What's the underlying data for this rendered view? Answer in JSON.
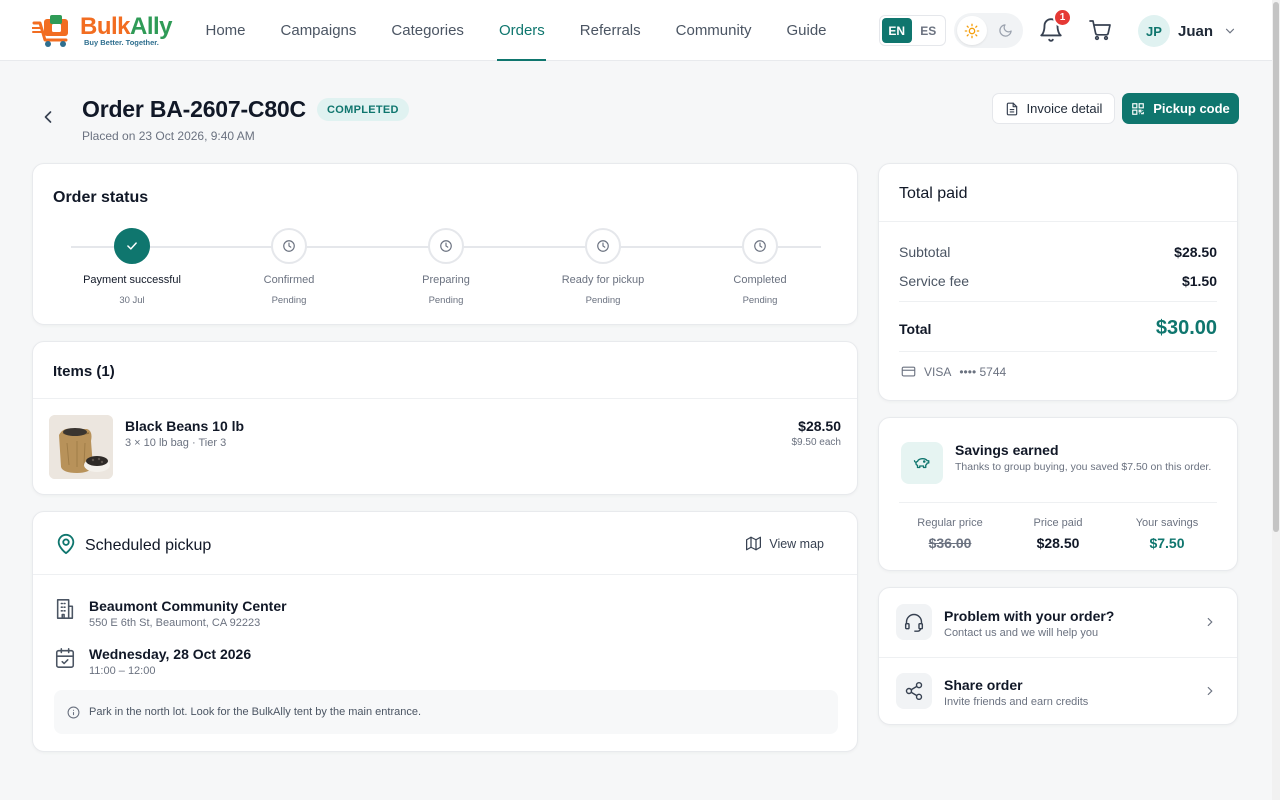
{
  "brand": {
    "name_part1": "Bulk",
    "name_part2": "Ally",
    "tagline": "Buy Better. Together.",
    "primary_color": "#0f766e",
    "orange": "#f26d21",
    "green": "#2f9b57"
  },
  "nav": {
    "items": [
      {
        "label": "Home",
        "active": false
      },
      {
        "label": "Campaigns",
        "active": false
      },
      {
        "label": "Categories",
        "active": false
      },
      {
        "label": "Orders",
        "active": true
      },
      {
        "label": "Referrals",
        "active": false
      },
      {
        "label": "Community",
        "active": false
      },
      {
        "label": "Guide",
        "active": false
      }
    ]
  },
  "header": {
    "lang_en": "EN",
    "lang_es": "ES",
    "lang_selected": "EN",
    "theme_selected": "light",
    "notification_count": "1",
    "user_initials": "JP",
    "user_name": "Juan"
  },
  "order": {
    "title": "Order BA-2607-C80C",
    "status": "COMPLETED",
    "placed": "Placed on 23 Oct 2026, 9:40 AM",
    "invoice_label": "Invoice detail",
    "pickup_code_label": "Pickup code"
  },
  "status_card": {
    "title": "Order status",
    "steps": [
      {
        "label": "Payment successful",
        "date": "30 Jul",
        "done": true
      },
      {
        "label": "Confirmed",
        "date": "Pending",
        "done": false
      },
      {
        "label": "Preparing",
        "date": "Pending",
        "done": false
      },
      {
        "label": "Ready for pickup",
        "date": "Pending",
        "done": false
      },
      {
        "label": "Completed",
        "date": "Pending",
        "done": false
      }
    ]
  },
  "items_card": {
    "title": "Items (1)",
    "items": [
      {
        "name": "Black Beans 10 lb",
        "detail": "3 × 10 lb bag · Tier 3",
        "price": "$28.50",
        "each": "$9.50 each"
      }
    ]
  },
  "pickup_card": {
    "title": "Scheduled pickup",
    "view_map": "View map",
    "location_name": "Beaumont Community Center",
    "location_address": "550 E 6th St, Beaumont, CA 92223",
    "date": "Wednesday, 28 Oct 2026",
    "time": "11:00 – 12:00",
    "note": "Park in the north lot. Look for the BulkAlly tent by the main entrance."
  },
  "paid_card": {
    "title": "Total paid",
    "subtotal_label": "Subtotal",
    "subtotal": "$28.50",
    "fee_label": "Service fee",
    "fee": "$1.50",
    "total_label": "Total",
    "total": "$30.00",
    "card_brand": "VISA",
    "card_masked": "•••• 5744"
  },
  "savings_card": {
    "title": "Savings earned",
    "desc": "Thanks to group buying, you saved $7.50 on this order.",
    "regular_label": "Regular price",
    "regular": "$36.00",
    "paid_label": "Price paid",
    "paid": "$28.50",
    "savings_label": "Your savings",
    "savings": "$7.50"
  },
  "help_card": {
    "problem_title": "Problem with your order?",
    "problem_sub": "Contact us and we will help you",
    "share_title": "Share order",
    "share_sub": "Invite friends and earn credits"
  }
}
